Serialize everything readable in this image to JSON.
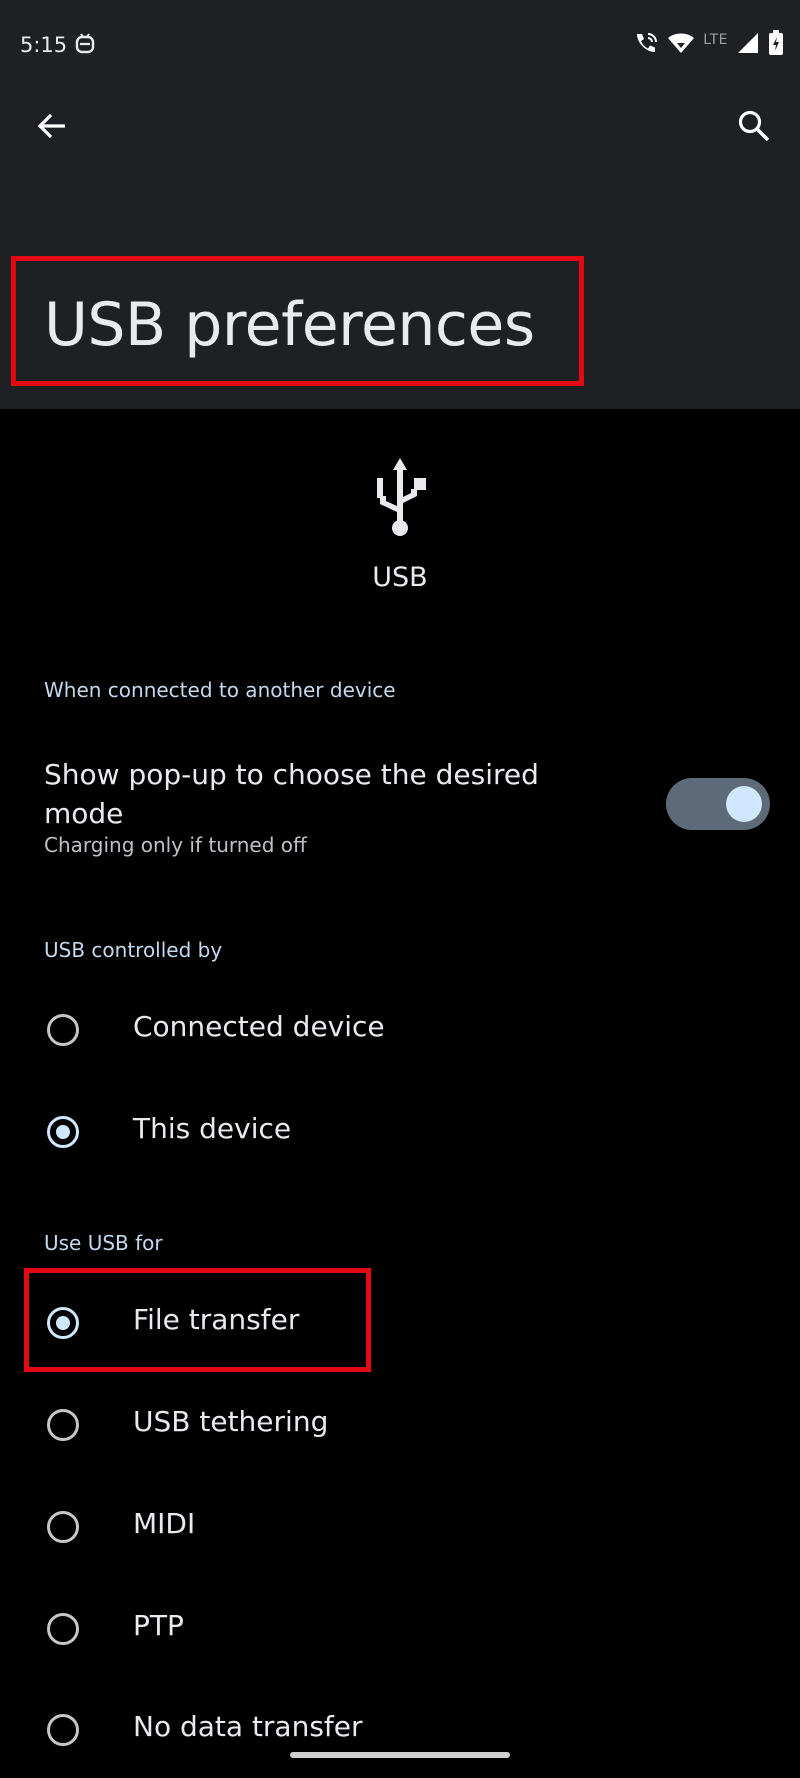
{
  "status_bar": {
    "time": "5:15",
    "network_label": "LTE",
    "icons": [
      "app-notification-icon",
      "wifi-calling-icon",
      "wifi-icon",
      "cell-signal-icon",
      "battery-icon"
    ]
  },
  "app_bar": {
    "back_icon": "arrow-back-icon",
    "search_icon": "search-icon",
    "title": "USB preferences"
  },
  "hero": {
    "icon": "usb-icon",
    "label": "USB"
  },
  "sections": {
    "connected_header": "When connected to another device",
    "popup_toggle": {
      "title": "Show pop-up to choose the desired mode",
      "summary": "Charging only if turned off",
      "enabled": true
    },
    "controlled_by_header": "USB controlled by",
    "controlled_by_options": [
      {
        "label": "Connected device",
        "checked": false
      },
      {
        "label": "This device",
        "checked": true
      }
    ],
    "use_for_header": "Use USB for",
    "use_for_options": [
      {
        "label": "File transfer",
        "checked": true
      },
      {
        "label": "USB tethering",
        "checked": false
      },
      {
        "label": "MIDI",
        "checked": false
      },
      {
        "label": "PTP",
        "checked": false
      },
      {
        "label": "No data transfer",
        "checked": false
      }
    ]
  },
  "colors": {
    "appbar_bg": "#1f2023",
    "page_bg": "#000000",
    "accent": "#cfe7ff",
    "highlight_box": "#e50914"
  }
}
